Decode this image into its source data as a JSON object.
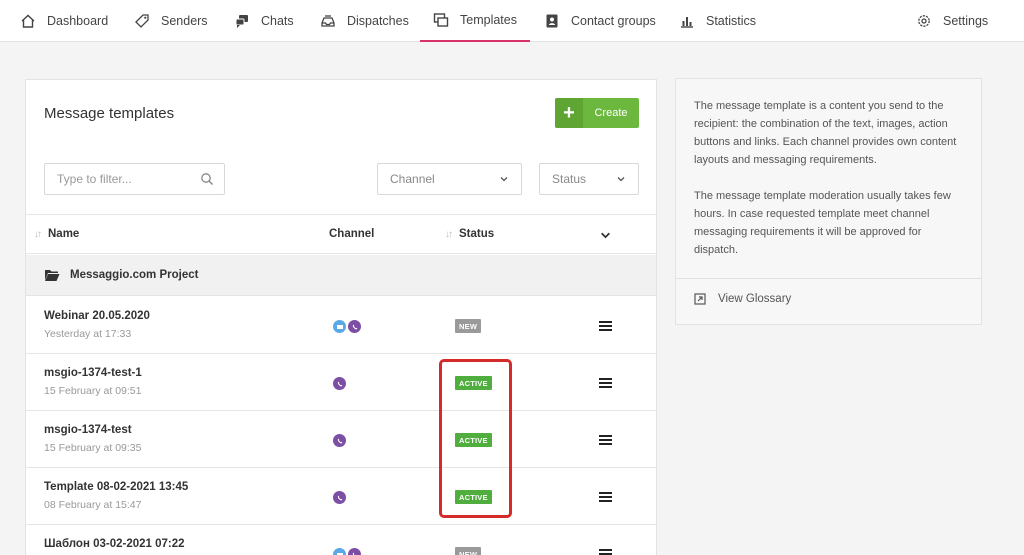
{
  "nav": {
    "items": [
      {
        "label": "Dashboard",
        "icon": "home-icon"
      },
      {
        "label": "Senders",
        "icon": "tag-icon"
      },
      {
        "label": "Chats",
        "icon": "chat-bubbles-icon"
      },
      {
        "label": "Dispatches",
        "icon": "inbox-tray-icon"
      },
      {
        "label": "Templates",
        "icon": "template-icon"
      },
      {
        "label": "Contact groups",
        "icon": "address-book-icon"
      },
      {
        "label": "Statistics",
        "icon": "bar-chart-icon"
      }
    ],
    "active": "Templates",
    "settings_label": "Settings",
    "accent_color": "#d9316b"
  },
  "main": {
    "title": "Message templates",
    "create_label": "Create",
    "filter_placeholder": "Type to filter...",
    "channel_select": "Channel",
    "status_select": "Status",
    "columns": {
      "name": "Name",
      "channel": "Channel",
      "status": "Status"
    },
    "group_name": "Messaggio.com Project",
    "rows": [
      {
        "name": "Webinar 20.05.2020",
        "date": "Yesterday at 17:33",
        "channels": [
          "sms",
          "viber"
        ],
        "status": "NEW"
      },
      {
        "name": "msgio-1374-test-1",
        "date": "15 February at 09:51",
        "channels": [
          "viber"
        ],
        "status": "ACTIVE"
      },
      {
        "name": "msgio-1374-test",
        "date": "15 February at 09:35",
        "channels": [
          "viber"
        ],
        "status": "ACTIVE"
      },
      {
        "name": "Template 08-02-2021 13:45",
        "date": "08 February at 15:47",
        "channels": [
          "viber"
        ],
        "status": "ACTIVE"
      },
      {
        "name": "Шаблон 03-02-2021 07:22",
        "date": "",
        "channels": [
          "sms",
          "viber"
        ],
        "status": "NEW"
      }
    ],
    "colors": {
      "create": "#6cb83f",
      "active": "#4fae3e",
      "new": "#9a9a9a",
      "highlight": "#d62b2b"
    }
  },
  "info": {
    "paragraph1": "The message template is a content you send to the recipient: the combination of the text, images, action buttons and links. Each channel provides own content layouts and messaging requirements.",
    "paragraph2": "The message template moderation usually takes few hours. In case requested template meet channel messaging requirements it will be approved for dispatch.",
    "glossary_label": "View Glossary"
  }
}
